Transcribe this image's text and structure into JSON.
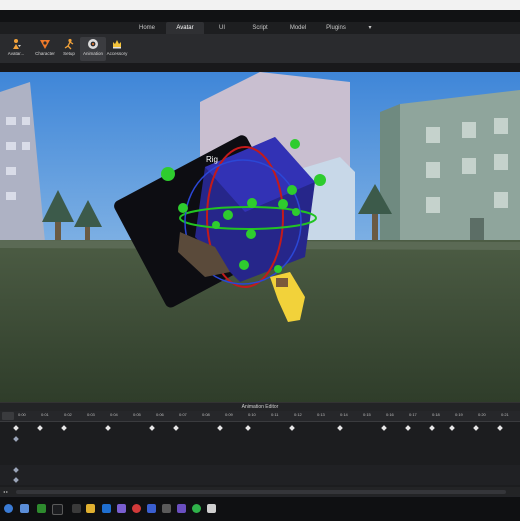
{
  "tabs": [
    {
      "label": "Home",
      "active": false
    },
    {
      "label": "Avatar",
      "active": true
    },
    {
      "label": "UI",
      "active": false
    },
    {
      "label": "Script",
      "active": false
    },
    {
      "label": "Model",
      "active": false
    },
    {
      "label": "Plugins",
      "active": false
    },
    {
      "label": "▾",
      "active": false
    }
  ],
  "ribbon": [
    {
      "label": "Avatar...",
      "icon": "avatar-importer-icon"
    },
    {
      "label": "Character",
      "icon": "character-icon"
    },
    {
      "label": "Setup",
      "icon": "rig-setup-icon"
    },
    {
      "label": "Animation",
      "icon": "animation-editor-icon"
    },
    {
      "label": "Accessory",
      "icon": "accessory-icon"
    }
  ],
  "viewport": {
    "rig_label": "Rig"
  },
  "animation_editor": {
    "title": "Animation Editor",
    "ruler_ticks": [
      "0:00",
      "0:01",
      "0:02",
      "0:03",
      "0:04",
      "0:05",
      "0:06",
      "0:07",
      "0:08",
      "0:09",
      "0:10",
      "0:11",
      "0:12",
      "0:13",
      "0:14",
      "0:15",
      "0:16",
      "0:17",
      "0:18",
      "0:19",
      "0:20",
      "0:21"
    ],
    "footer": "◂ ▸"
  },
  "colors": {
    "accent": "#2b6cd6",
    "ribbon_bg": "#2a2b2e",
    "sky": "#6fb2ea",
    "grass": "#3d4f35",
    "rig_cube": "#2a2a8c",
    "rig_handle": "#2ecc2e"
  }
}
